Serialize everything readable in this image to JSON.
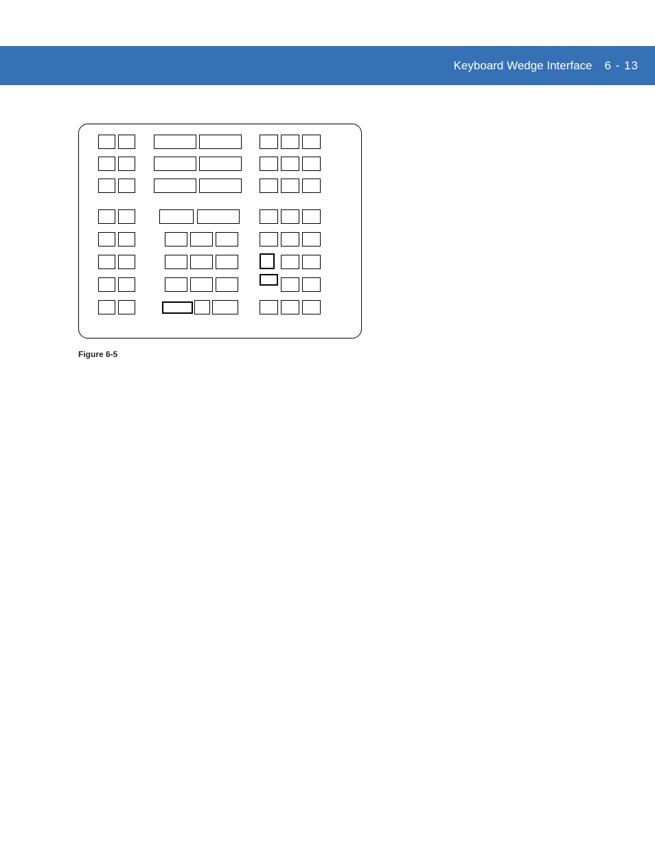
{
  "header": {
    "title": "Keyboard Wedge Interface",
    "page": "6 - 13"
  },
  "figure": {
    "caption": "Figure 6-5"
  }
}
